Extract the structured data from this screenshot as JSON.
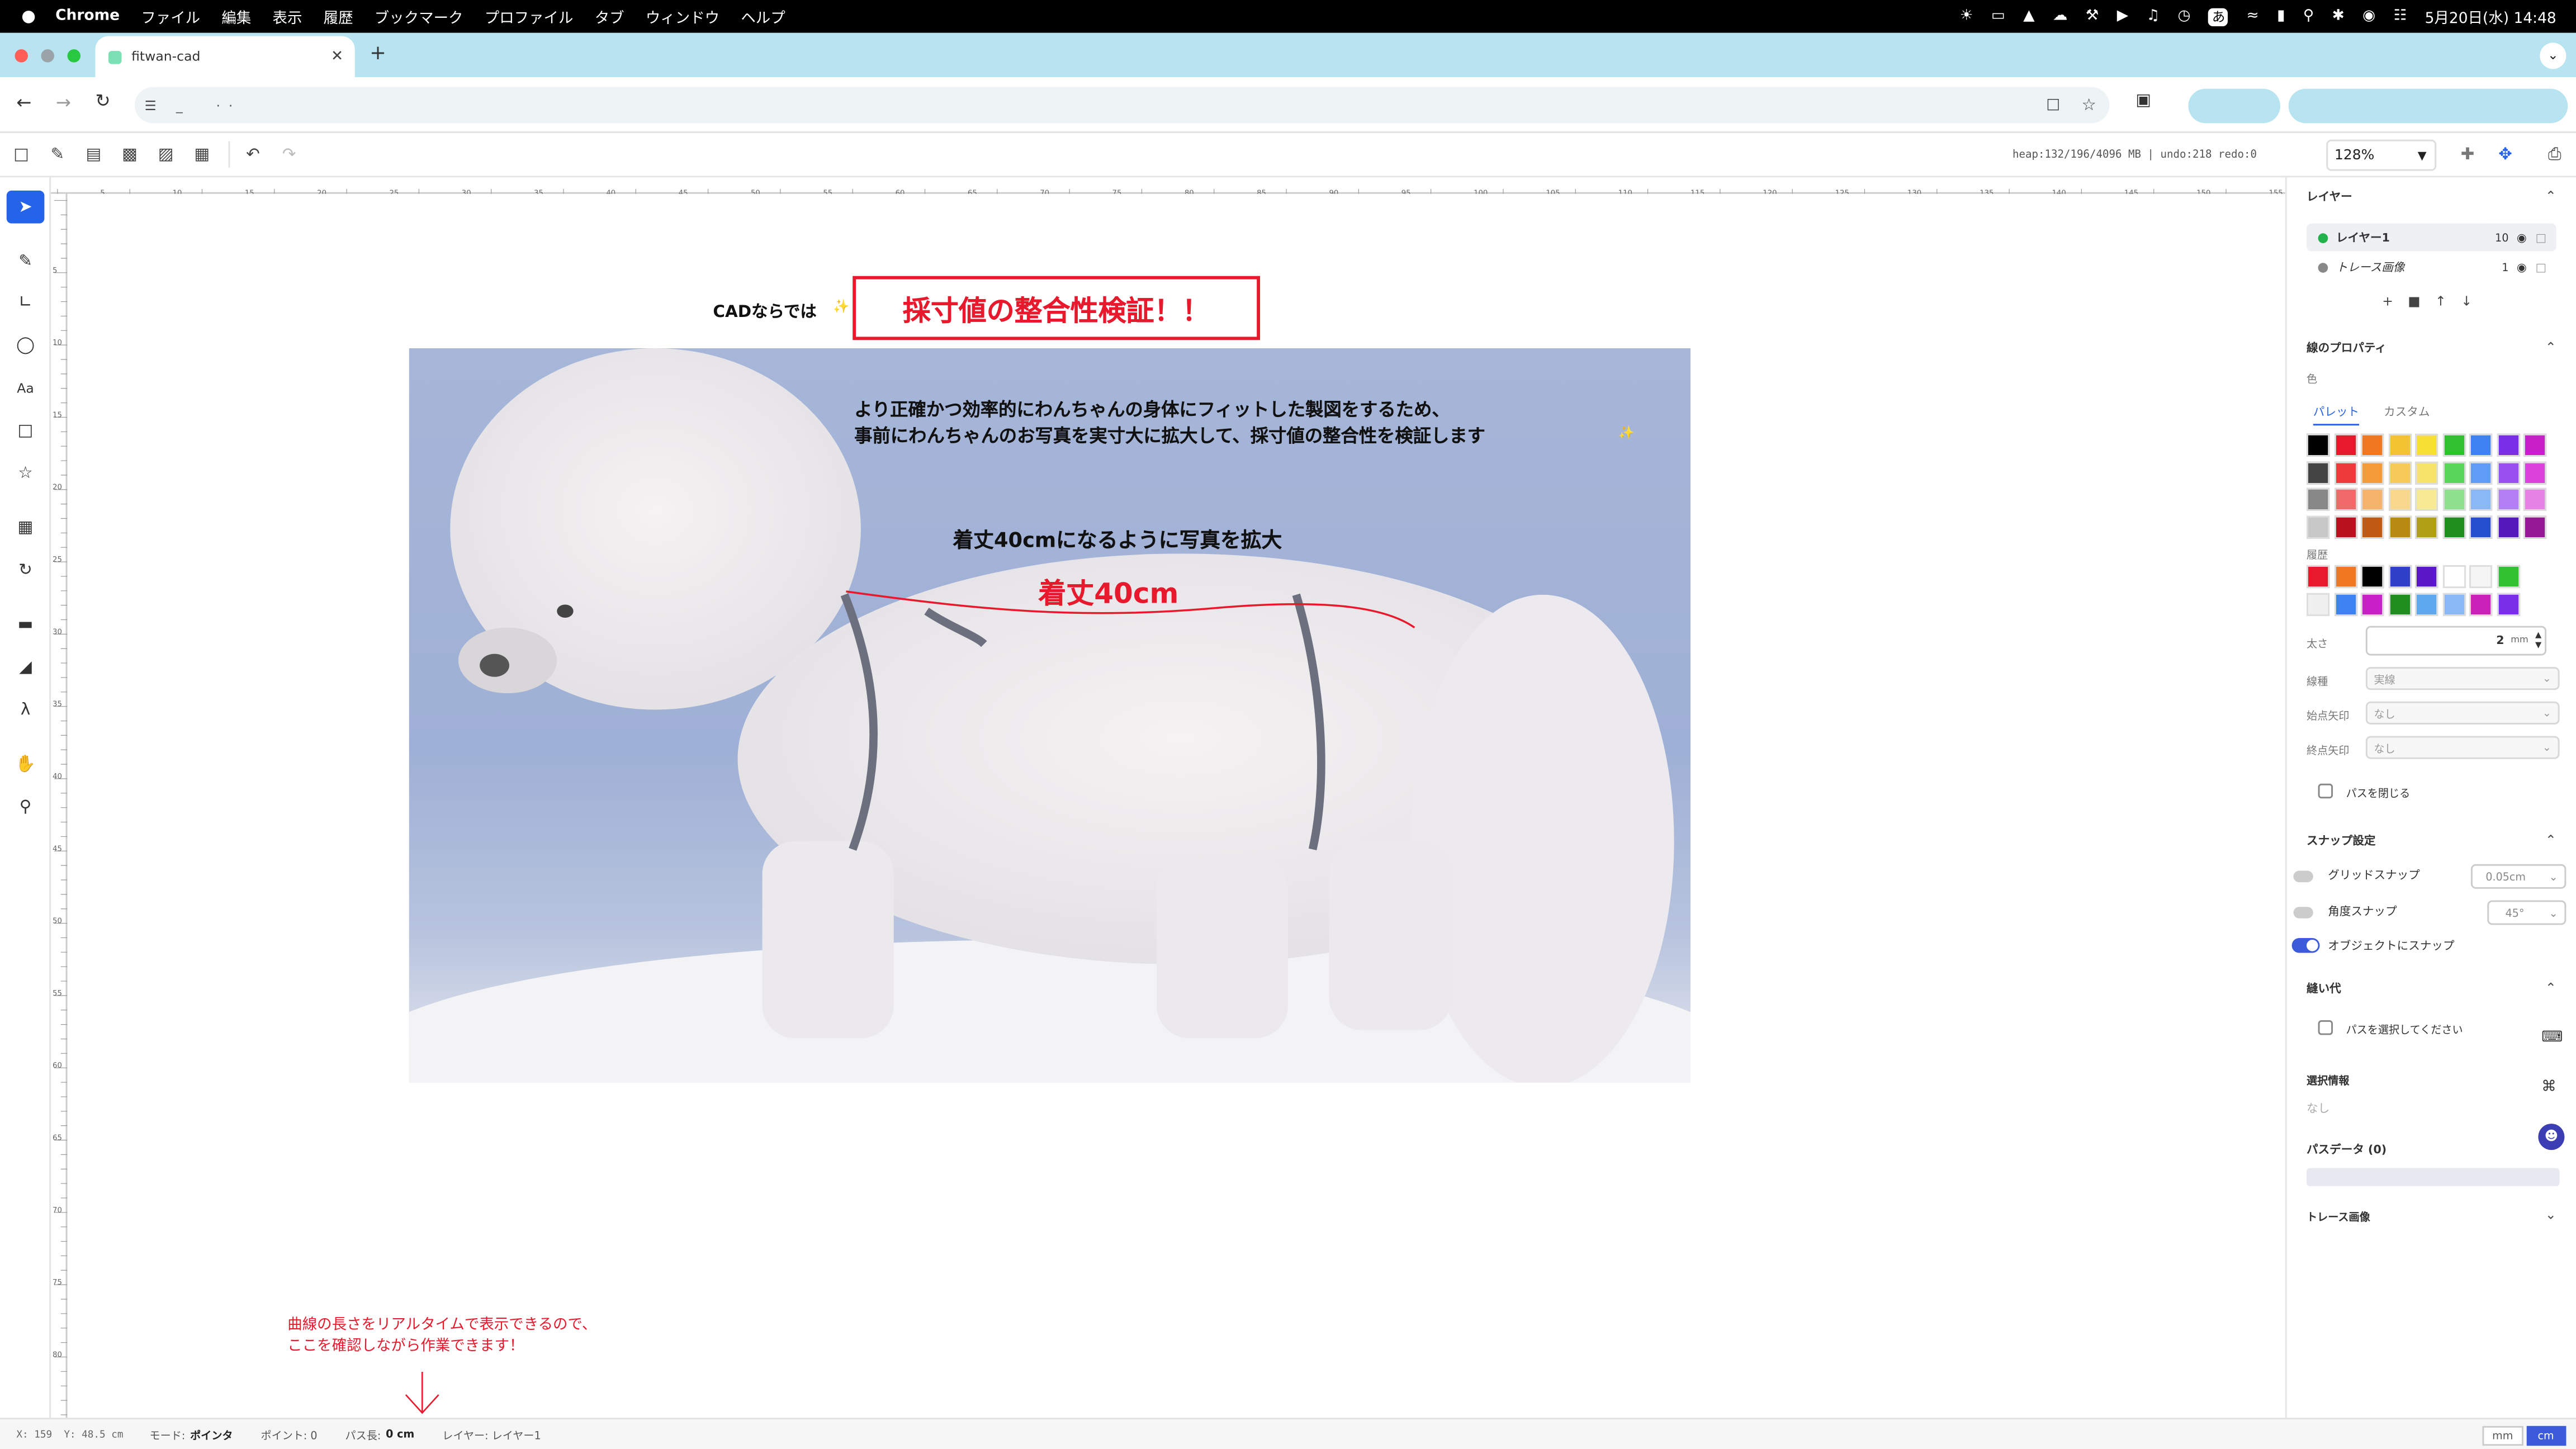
{
  "menubar": {
    "apple": "",
    "app": "Chrome",
    "items": [
      "ファイル",
      "編集",
      "表示",
      "履歴",
      "ブックマーク",
      "プロファイル",
      "タブ",
      "ウィンドウ",
      "ヘルプ"
    ],
    "ime": "あ",
    "clock": "5月20日(水) 14:48"
  },
  "browser": {
    "tab_title": "fitwan-cad",
    "new_tab": "+",
    "url": "_        ·  ·"
  },
  "toolbar": {
    "info": "heap:132/196/4096 MB | undo:218 redo:0",
    "zoom": "128%"
  },
  "canvas": {
    "caption": "CADならでは",
    "headline": "採寸値の整合性検証！！",
    "desc1": "より正確かつ効率的にわんちゃんの身体にフィットした製図をするため、",
    "desc2": "事前にわんちゃんのお写真を実寸大に拡大して、採寸値の整合性を検証します",
    "sub": "着丈40cmになるように写真を拡大",
    "measure": "着丈40cm",
    "note1": "曲線の長さをリアルタイムで表示できるので、",
    "note2": "ここを確認しながら作業できます！",
    "sparkle": "✨",
    "colors": {
      "accent_red": "#e8192c",
      "headline_border": "#e8192c",
      "photo_bg": "#9fb2d6"
    }
  },
  "panel": {
    "layers_title": "レイヤー",
    "layers": [
      {
        "name": "レイヤー1",
        "count": "10",
        "active": true
      },
      {
        "name": "トレース画像",
        "count": "1",
        "active": false
      }
    ],
    "stroke_title": "線のプロパティ",
    "color_label": "色",
    "tab_palette": "パレット",
    "tab_custom": "カスタム",
    "palette": [
      [
        "#000000",
        "#e8192c",
        "#f07820",
        "#f2c230",
        "#f5e033",
        "#30c030",
        "#3c82f0",
        "#7a2ee8",
        "#c820c8"
      ],
      [
        "#444444",
        "#ee3a3a",
        "#f29b38",
        "#f5c95a",
        "#f5e36a",
        "#5ad65a",
        "#5e9cf5",
        "#9a4ff0",
        "#dc42dc"
      ],
      [
        "#888888",
        "#f06a6a",
        "#f5b36e",
        "#f7d88c",
        "#f7ea94",
        "#8ee08e",
        "#8ab8f7",
        "#b27ef3",
        "#e682e6"
      ],
      [
        "#c8c8c8",
        "#b8121e",
        "#c05a12",
        "#b88a12",
        "#b0a015",
        "#1e8e1e",
        "#2450d0",
        "#5418b8",
        "#961896"
      ]
    ],
    "history_label": "履歴",
    "history": [
      [
        "#e8192c",
        "#f07820",
        "#000000",
        "#3040c8",
        "#5a18c8",
        "#ffffff",
        "#f5f5f5",
        "#30c030"
      ],
      [
        "#f0f0f0",
        "#3c82f0",
        "#c820c8",
        "#1e8e1e",
        "#5ea8f0",
        "#8ab8f7",
        "#c820b8",
        "#7a2ee8"
      ]
    ],
    "width_label": "太さ",
    "width_value": "2",
    "width_unit": "mm",
    "linetype_label": "線種",
    "linetype_value": "実線",
    "start_arrow_label": "始点矢印",
    "start_arrow_value": "なし",
    "end_arrow_label": "終点矢印",
    "end_arrow_value": "なし",
    "close_path": "パスを閉じる",
    "snap_title": "スナップ設定",
    "grid_snap": "グリッドスナップ",
    "grid_snap_value": "0.05cm",
    "angle_snap": "角度スナップ",
    "angle_snap_value": "45°",
    "object_snap": "オブジェクトにスナップ",
    "seam_title": "縫い代",
    "seam_hint": "パスを選択してください",
    "selection_title": "選択情報",
    "selection_value": "なし",
    "pathdata_title": "パスデータ (0)",
    "trace_title": "トレース画像"
  },
  "status": {
    "coords": "X: 159  Y: 48.5 cm",
    "mode_label": "モード:",
    "mode_value": "ポインタ",
    "points": "ポイント: 0",
    "path_label": "パス長:",
    "path_value": "0 cm",
    "layer": "レイヤー: レイヤー1",
    "unit_mm": "mm",
    "unit_cm": "cm"
  },
  "ruler": {
    "h": [
      "5",
      "10",
      "15",
      "20",
      "25",
      "30",
      "35",
      "40",
      "45",
      "50",
      "55",
      "60",
      "65",
      "70",
      "75",
      "80",
      "85",
      "90",
      "95",
      "100",
      "105",
      "110",
      "115",
      "120",
      "125",
      "130",
      "135",
      "140",
      "145",
      "150",
      "155"
    ],
    "v": [
      "5",
      "10",
      "15",
      "20",
      "25",
      "30",
      "35",
      "40",
      "45",
      "50",
      "55",
      "60",
      "65",
      "70",
      "75",
      "80"
    ]
  }
}
